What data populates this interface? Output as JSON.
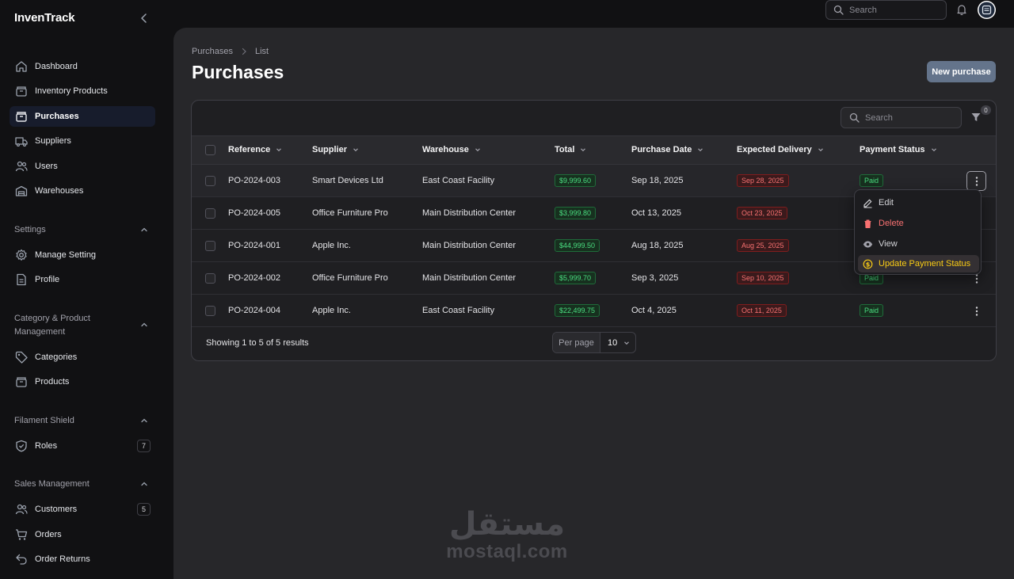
{
  "app": {
    "brand": "InvenTrack"
  },
  "topbar": {
    "search_placeholder": "Search"
  },
  "sidebar": {
    "items": [
      {
        "label": "Dashboard",
        "icon": "home-icon"
      },
      {
        "label": "Inventory Products",
        "icon": "box-icon"
      },
      {
        "label": "Purchases",
        "icon": "box-icon",
        "active": true
      },
      {
        "label": "Suppliers",
        "icon": "truck-icon"
      },
      {
        "label": "Users",
        "icon": "users-icon"
      },
      {
        "label": "Warehouses",
        "icon": "archive-icon"
      }
    ],
    "groups": {
      "settings": {
        "title": "Settings",
        "items": [
          "Manage Setting",
          "Profile"
        ]
      },
      "category": {
        "title": "Category & Product Management",
        "items": [
          "Categories",
          "Products"
        ]
      },
      "shield": {
        "title": "Filament Shield",
        "items": [
          "Roles"
        ],
        "roles_badge": "7"
      },
      "sales": {
        "title": "Sales Management",
        "items": [
          "Customers",
          "Orders",
          "Order Returns"
        ],
        "customers_badge": "5"
      }
    }
  },
  "breadcrumb": {
    "parent": "Purchases",
    "current": "List"
  },
  "page": {
    "title": "Purchases",
    "new_button": "New purchase"
  },
  "table": {
    "search_placeholder": "Search",
    "filter_count": "0",
    "columns": [
      "Reference",
      "Supplier",
      "Warehouse",
      "Total",
      "Purchase Date",
      "Expected Delivery",
      "Payment Status"
    ],
    "rows": [
      {
        "reference": "PO-2024-003",
        "supplier": "Smart Devices Ltd",
        "warehouse": "East Coast Facility",
        "total": "$9,999.60",
        "purchase_date": "Sep 18, 2025",
        "expected_delivery": "Sep 28, 2025",
        "payment_status": "Paid"
      },
      {
        "reference": "PO-2024-005",
        "supplier": "Office Furniture Pro",
        "warehouse": "Main Distribution Center",
        "total": "$3,999.80",
        "purchase_date": "Oct 13, 2025",
        "expected_delivery": "Oct 23, 2025",
        "payment_status": ""
      },
      {
        "reference": "PO-2024-001",
        "supplier": "Apple Inc.",
        "warehouse": "Main Distribution Center",
        "total": "$44,999.50",
        "purchase_date": "Aug 18, 2025",
        "expected_delivery": "Aug 25, 2025",
        "payment_status": ""
      },
      {
        "reference": "PO-2024-002",
        "supplier": "Office Furniture Pro",
        "warehouse": "Main Distribution Center",
        "total": "$5,999.70",
        "purchase_date": "Sep 3, 2025",
        "expected_delivery": "Sep 10, 2025",
        "payment_status": "Paid"
      },
      {
        "reference": "PO-2024-004",
        "supplier": "Apple Inc.",
        "warehouse": "East Coast Facility",
        "total": "$22,499.75",
        "purchase_date": "Oct 4, 2025",
        "expected_delivery": "Oct 11, 2025",
        "payment_status": "Paid"
      }
    ],
    "footer": {
      "summary": "Showing 1 to 5 of 5 results",
      "per_page_label": "Per page",
      "per_page_value": "10"
    }
  },
  "row_menu": {
    "edit": "Edit",
    "delete": "Delete",
    "view": "View",
    "update_payment": "Update Payment Status"
  },
  "watermark": {
    "arabic": "مستقل",
    "latin": "mostaql.com"
  },
  "colors": {
    "accent_button": "#64748b",
    "success": "#4ade80",
    "danger": "#f87171",
    "warning": "#facc15"
  }
}
